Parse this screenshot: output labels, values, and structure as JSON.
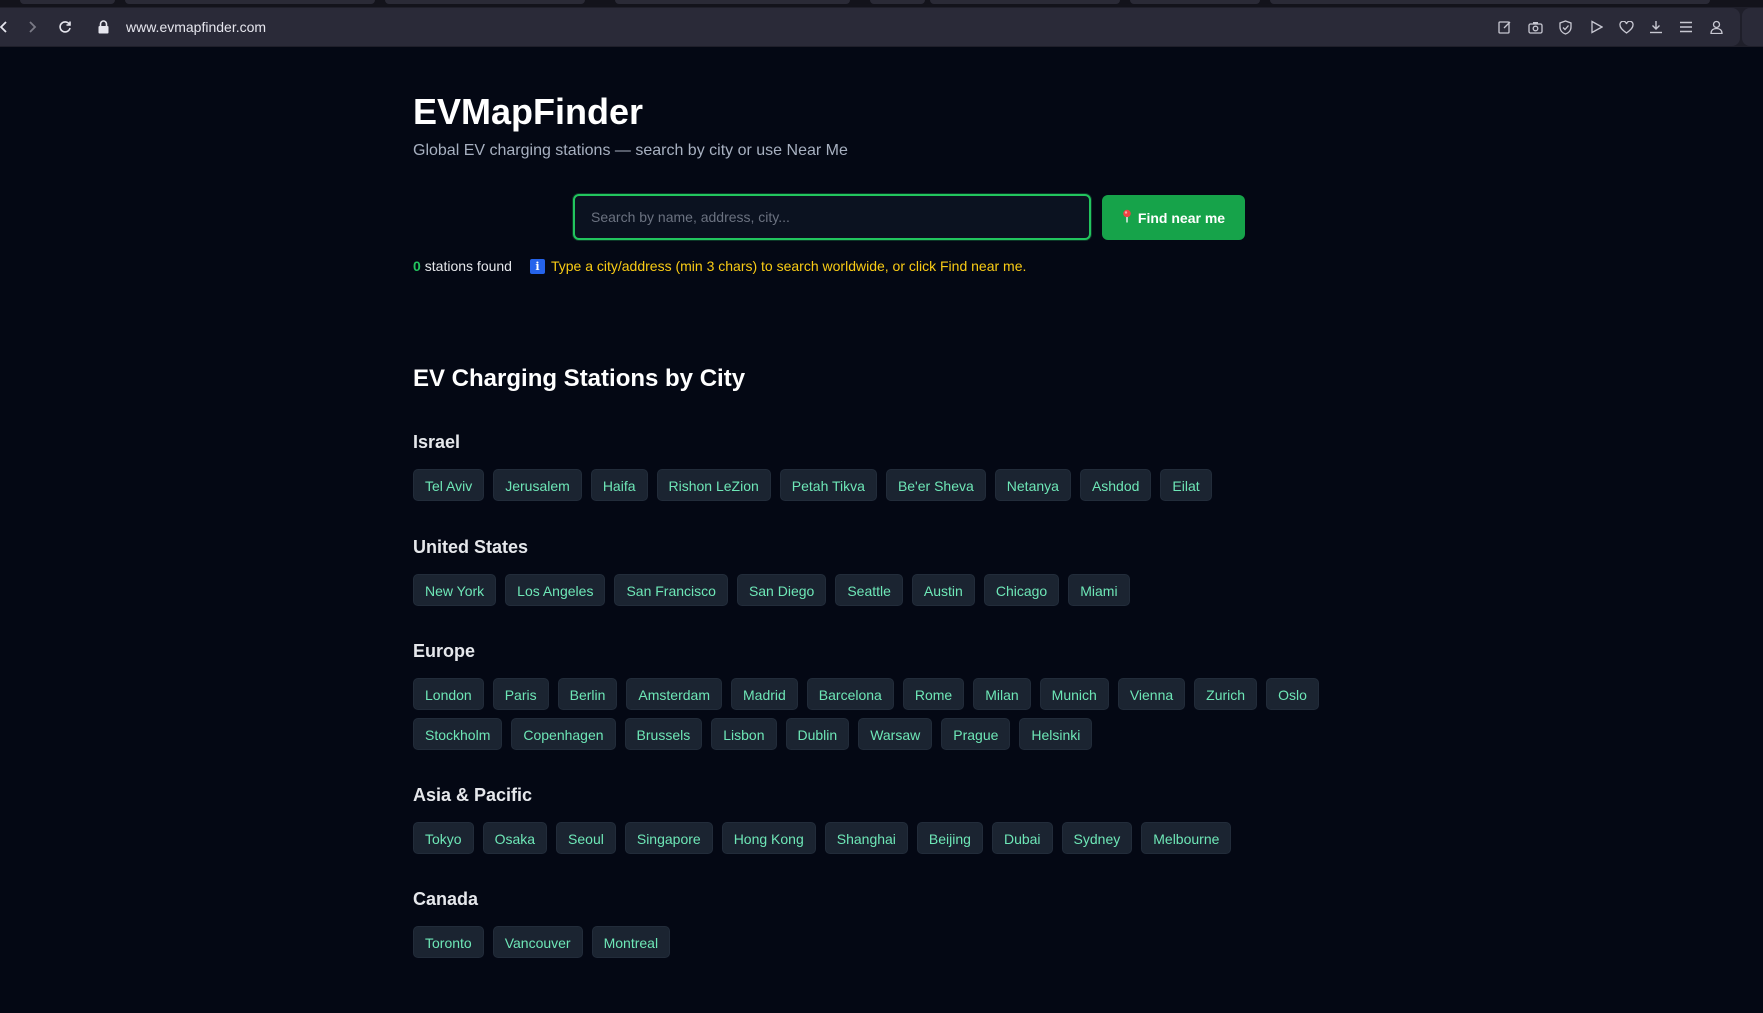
{
  "browser": {
    "url": "www.evmapfinder.com",
    "icons": [
      "back-icon",
      "forward-icon",
      "reload-icon",
      "lock-icon",
      "edit-icon",
      "camera-icon",
      "shield-icon",
      "play-icon",
      "heart-icon",
      "download-icon",
      "menu-icon",
      "account-icon"
    ]
  },
  "header": {
    "title": "EVMapFinder",
    "subtitle": "Global EV charging stations — search by city or use Near Me"
  },
  "search": {
    "placeholder": "Search by name, address, city...",
    "value": "",
    "find_button_label": "Find near me",
    "find_button_icon": "pin-icon"
  },
  "status": {
    "count": "0",
    "count_label": "stations found",
    "info_icon": "i",
    "hint": "Type a city/address (min 3 chars) to search worldwide, or click Find near me."
  },
  "cities_section": {
    "title": "EV Charging Stations by City",
    "regions": [
      {
        "name": "Israel",
        "cities": [
          "Tel Aviv",
          "Jerusalem",
          "Haifa",
          "Rishon LeZion",
          "Petah Tikva",
          "Be'er Sheva",
          "Netanya",
          "Ashdod",
          "Eilat"
        ]
      },
      {
        "name": "United States",
        "cities": [
          "New York",
          "Los Angeles",
          "San Francisco",
          "San Diego",
          "Seattle",
          "Austin",
          "Chicago",
          "Miami"
        ]
      },
      {
        "name": "Europe",
        "cities": [
          "London",
          "Paris",
          "Berlin",
          "Amsterdam",
          "Madrid",
          "Barcelona",
          "Rome",
          "Milan",
          "Munich",
          "Vienna",
          "Zurich",
          "Oslo",
          "Stockholm",
          "Copenhagen",
          "Brussels",
          "Lisbon",
          "Dublin",
          "Warsaw",
          "Prague",
          "Helsinki"
        ]
      },
      {
        "name": "Asia & Pacific",
        "cities": [
          "Tokyo",
          "Osaka",
          "Seoul",
          "Singapore",
          "Hong Kong",
          "Shanghai",
          "Beijing",
          "Dubai",
          "Sydney",
          "Melbourne"
        ]
      },
      {
        "name": "Canada",
        "cities": [
          "Toronto",
          "Vancouver",
          "Montreal"
        ]
      }
    ]
  },
  "colors": {
    "accent": "#22c55e",
    "chip_text": "#6ee7b7",
    "hint": "#facc15",
    "background": "#040814"
  }
}
